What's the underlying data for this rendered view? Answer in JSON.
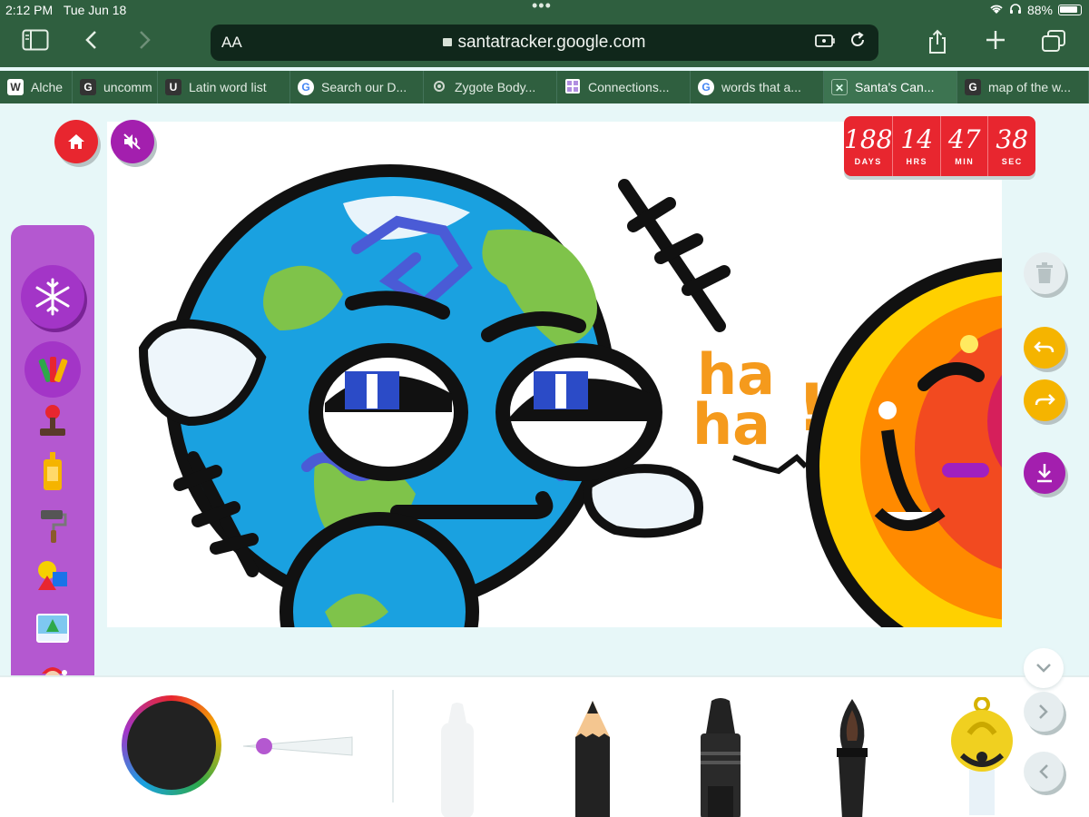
{
  "status": {
    "time": "2:12 PM",
    "date": "Tue Jun 18",
    "battery": "88%"
  },
  "browser": {
    "aa_label": "AA",
    "url": "santatracker.google.com",
    "tabs": [
      {
        "favicon": "W",
        "title": "Alche"
      },
      {
        "favicon": "G",
        "title": "uncomm"
      },
      {
        "favicon": "U",
        "title": "Latin word list"
      },
      {
        "favicon": "G",
        "title": "Search our D..."
      },
      {
        "favicon": "zygote",
        "title": "Zygote Body..."
      },
      {
        "favicon": "grid",
        "title": "Connections..."
      },
      {
        "favicon": "G",
        "title": "words that a..."
      },
      {
        "favicon": "X",
        "title": "Santa's Can...",
        "active": true
      },
      {
        "favicon": "G",
        "title": "map of the w..."
      }
    ]
  },
  "countdown": {
    "days": "188",
    "days_label": "DAYS",
    "hrs": "14",
    "hrs_label": "HRS",
    "min": "47",
    "min_label": "MIN",
    "sec": "38",
    "sec_label": "SEC"
  },
  "drawing": {
    "text_ha1": "ha",
    "text_ha2": "ha",
    "text_bang": "!"
  },
  "colors": {
    "sidebar": "#b458d0",
    "home": "#e8262f",
    "mute": "#a31fae",
    "undo": "#f5b400",
    "download": "#a31fae",
    "current_color": "#222222",
    "size_thumb": "#b458d0"
  },
  "icons": {
    "home": "home-icon",
    "mute": "mute-icon",
    "trash": "trash-icon",
    "undo": "undo-icon",
    "redo": "redo-icon",
    "download": "download-icon"
  }
}
